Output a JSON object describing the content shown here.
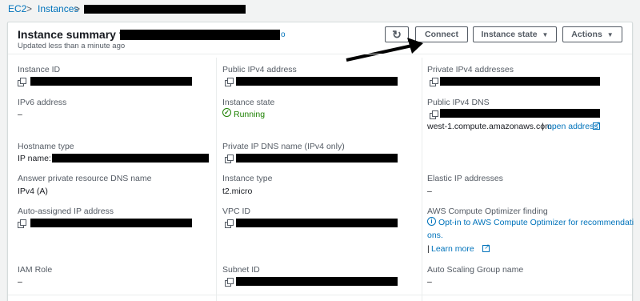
{
  "breadcrumb": {
    "root": "EC2",
    "sep": ">",
    "current": "Instances"
  },
  "header": {
    "title": "Instance summary for",
    "title_suffix": "o",
    "updated": "Updated less than a minute ago",
    "refresh_icon": "↻",
    "connect_label": "Connect",
    "instance_state_label": "Instance state",
    "actions_label": "Actions",
    "caret": "▼"
  },
  "fields": {
    "instance_id": {
      "label": "Instance ID"
    },
    "public_ipv4": {
      "label": "Public IPv4 address"
    },
    "private_ipv4": {
      "label": "Private IPv4 addresses"
    },
    "ipv6": {
      "label": "IPv6 address",
      "value": "–"
    },
    "instance_state": {
      "label": "Instance state",
      "value": "Running",
      "icon": "✓"
    },
    "public_dns": {
      "label": "Public IPv4 DNS",
      "value": "west-1.compute.amazonaws.com",
      "sep": "|",
      "link": "open address"
    },
    "hostname_type": {
      "label": "Hostname type",
      "value": "IP name:"
    },
    "private_dns": {
      "label": "Private IP DNS name (IPv4 only)"
    },
    "answer_dns": {
      "label": "Answer private resource DNS name",
      "value": "IPv4 (A)"
    },
    "instance_type": {
      "label": "Instance type",
      "value": "t2.micro"
    },
    "elastic_ip": {
      "label": "Elastic IP addresses",
      "value": "–"
    },
    "auto_ip": {
      "label": "Auto-assigned IP address"
    },
    "vpc_id": {
      "label": "VPC ID"
    },
    "optimizer": {
      "label": "AWS Compute Optimizer finding",
      "link_line1": "Opt-in to AWS Compute Optimizer for recommendati",
      "link_line2": "ons.",
      "sep": "|",
      "learn_more": "Learn more",
      "info_icon": "i"
    },
    "iam_role": {
      "label": "IAM Role",
      "value": "–"
    },
    "subnet_id": {
      "label": "Subnet ID"
    },
    "asg_name": {
      "label": "Auto Scaling Group name",
      "value": "–"
    }
  },
  "colors": {
    "link": "#0073bb",
    "running": "#1d8102",
    "redaction": "#000000"
  }
}
